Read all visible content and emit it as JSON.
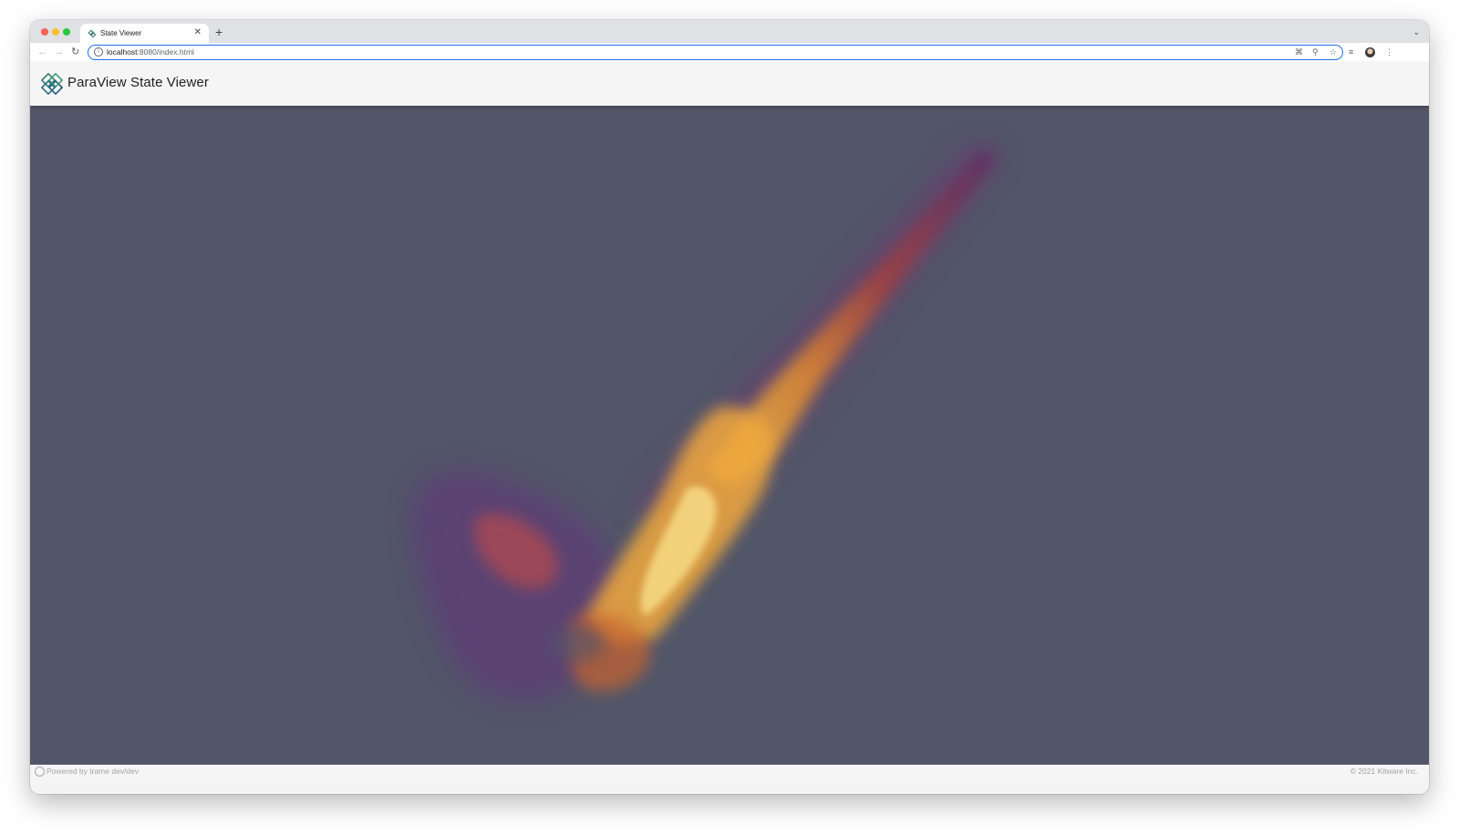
{
  "browser": {
    "tab": {
      "title": "State Viewer",
      "favicon": "paraview-logo-icon",
      "close_icon": "close-icon"
    },
    "new_tab_icon": "plus-icon",
    "tab_menu_icon": "chevron-down-icon",
    "nav": {
      "back_icon": "arrow-left-icon",
      "forward_icon": "arrow-right-icon",
      "reload_icon": "reload-icon"
    },
    "address": {
      "host": "localhost",
      "path": ":8080/index.html",
      "site_info_icon": "info-icon"
    },
    "omnibox_icons": [
      "qr-code-icon",
      "zoom-icon",
      "bookmark-star-icon"
    ],
    "toolbar_icons": [
      "reading-list-icon",
      "profile-avatar",
      "more-vert-icon"
    ],
    "accent_color": "#1a73e8"
  },
  "app": {
    "title": "ParaView State Viewer",
    "logo": "paraview-logo-icon",
    "header_bg": "#f5f5f5"
  },
  "viewport": {
    "background": "#525669",
    "content": "volume-render"
  },
  "footer": {
    "left": "Powered by trame dev/dev",
    "right": "© 2021 Kitware Inc.",
    "icon": "trame-logo-icon"
  }
}
